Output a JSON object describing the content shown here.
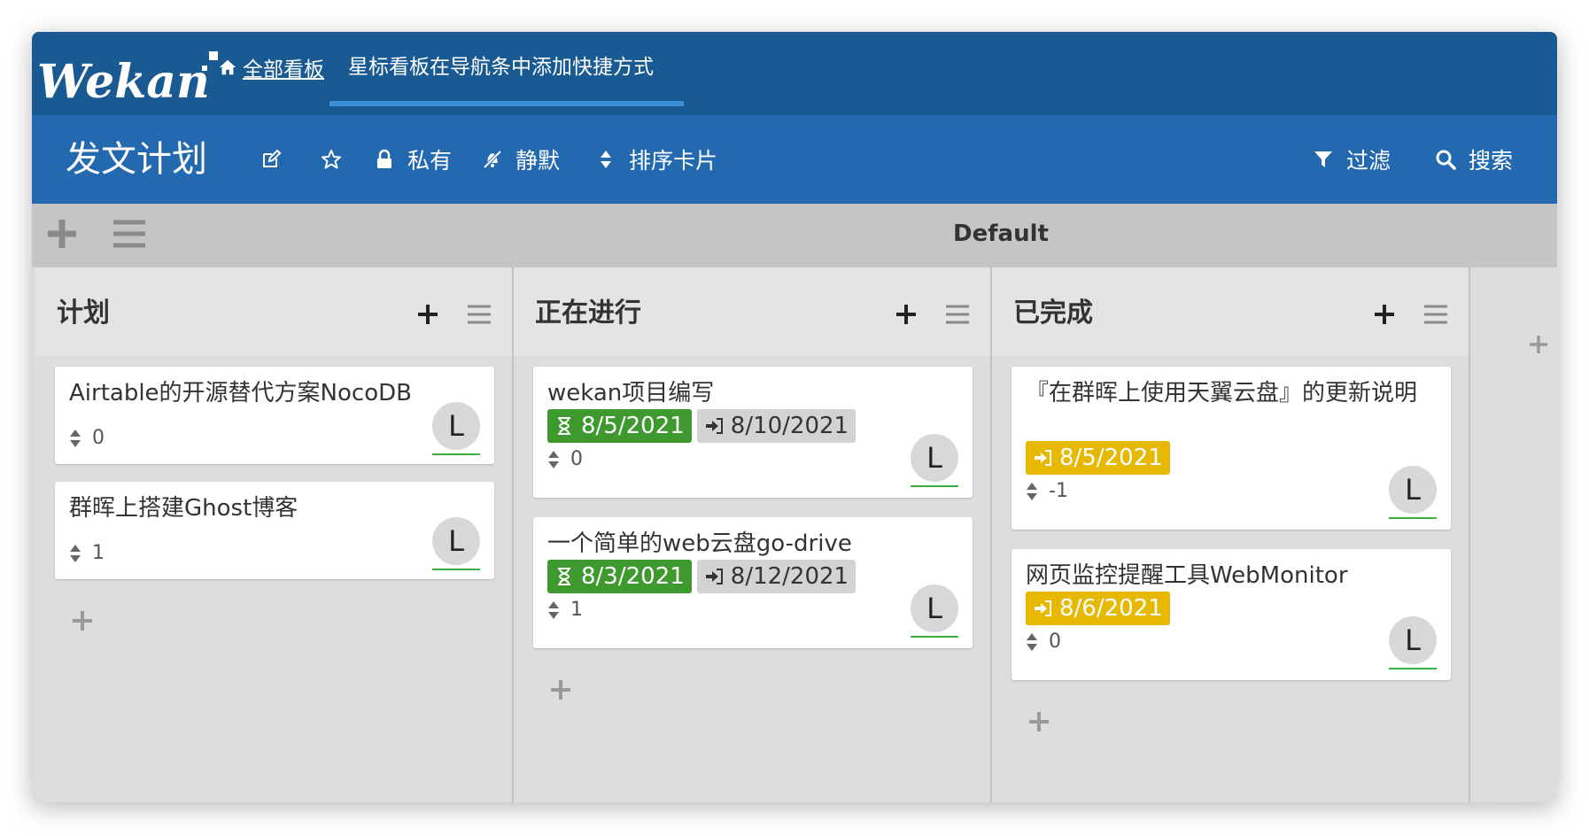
{
  "topnav": {
    "logo_text": "Wekan",
    "all_boards_label": "全部看板",
    "star_hint": "星标看板在导航条中添加快捷方式"
  },
  "board": {
    "title": "发文计划",
    "edit_icon": "edit-icon",
    "star_icon": "star-icon",
    "privacy_label": "私有",
    "watch_label": "静默",
    "sort_label": "排序卡片",
    "filter_label": "过滤",
    "search_label": "搜索"
  },
  "swimlane": {
    "title": "Default"
  },
  "lists": [
    {
      "title": "计划",
      "cards": [
        {
          "title": "Airtable的开源替代方案NocoDB",
          "sort": "0",
          "avatar": "L"
        },
        {
          "title": "群晖上搭建Ghost博客",
          "sort": "1",
          "avatar": "L"
        }
      ]
    },
    {
      "title": "正在进行",
      "cards": [
        {
          "title": "wekan项目编写",
          "received": "8/5/2021",
          "due": "8/10/2021",
          "sort": "0",
          "avatar": "L"
        },
        {
          "title": "一个简单的web云盘go-drive",
          "received": "8/3/2021",
          "due": "8/12/2021",
          "sort": "1",
          "avatar": "L"
        }
      ]
    },
    {
      "title": "已完成",
      "cards": [
        {
          "title": "『在群晖上使用天翼云盘』的更新说明",
          "end": "8/5/2021",
          "sort": "-1",
          "avatar": "L"
        },
        {
          "title": "网页监控提醒工具WebMonitor",
          "end": "8/6/2021",
          "sort": "0",
          "avatar": "L"
        }
      ]
    }
  ],
  "colors": {
    "topnav": "#1a5a93",
    "boardbar": "#2369b0",
    "received": "#3e9a2e",
    "end": "#e6b800",
    "due": "#d3d3d3"
  }
}
